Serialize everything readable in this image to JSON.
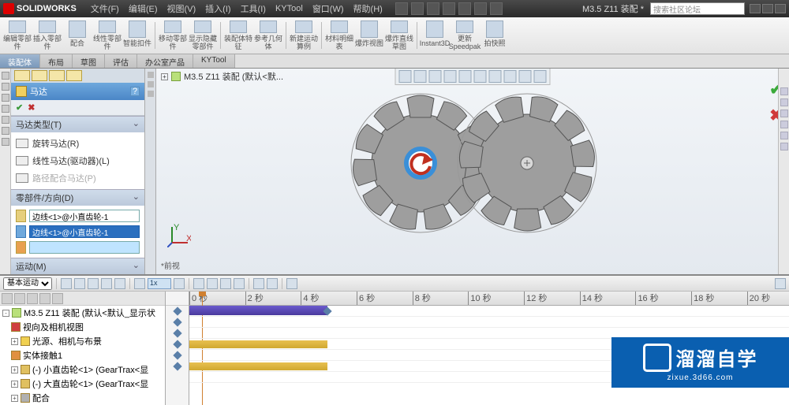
{
  "app": {
    "name": "SOLIDWORKS",
    "doc": "M3.5 Z11 装配 *"
  },
  "menu": [
    "文件(F)",
    "编辑(E)",
    "视图(V)",
    "插入(I)",
    "工具(I)",
    "KYTool",
    "窗口(W)",
    "帮助(H)"
  ],
  "search_placeholder": "搜索社区论坛",
  "ribbon": [
    "编辑零部件",
    "插入零部件",
    "配合",
    "线性零部件",
    "智能扣件",
    "移动零部件",
    "显示隐藏零部件",
    "装配体特征",
    "参考几何体",
    "新建运动算例",
    "材料明细表",
    "爆炸视图",
    "爆炸直线草图",
    "Instant3D",
    "更新Speedpak",
    "拍快照"
  ],
  "cmtabs": [
    "装配体",
    "布局",
    "草图",
    "评估",
    "办公室产品",
    "KYTool"
  ],
  "pm": {
    "title": "马达",
    "help": "?",
    "sect_type": "马达类型(T)",
    "opts": {
      "rot": "旋转马达(R)",
      "lin": "线性马达(驱动器)(L)",
      "path": "路径配合马达(P)"
    },
    "sect_dir": "零部件/方向(D)",
    "field1": "边线<1>@小直齿轮-1",
    "field2": "边线<1>@小直齿轮-1",
    "sect_motion": "运动(M)"
  },
  "breadcrumb": "M3.5 Z11 装配 (默认<默...",
  "viewlabel": "*前视",
  "motion": {
    "mode": "基本运动",
    "speed_label": "1x",
    "ticks": [
      "0 秒",
      "2 秒",
      "4 秒",
      "6 秒",
      "8 秒",
      "10 秒",
      "12 秒",
      "14 秒",
      "16 秒",
      "18 秒",
      "20 秒"
    ],
    "tree": {
      "root": "M3.5 Z11 装配 (默认<默认_显示状",
      "orient": "视向及相机视图",
      "lights": "光源、相机与布景",
      "contact": "实体接触1",
      "gear1": "(-) 小直齿轮<1> (GearTrax<显",
      "gear2": "(-) 大直齿轮<1> (GearTrax<显",
      "mates": "配合"
    }
  },
  "watermark": {
    "brand": "溜溜自学",
    "url": "zixue.3d66.com"
  }
}
